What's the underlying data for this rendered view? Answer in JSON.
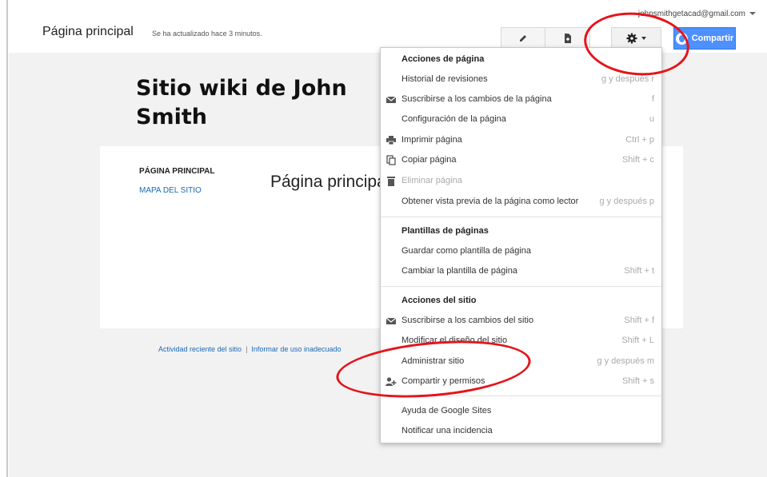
{
  "header": {
    "page_title": "Página principal",
    "updated": "Se ha actualizado hace 3 minutos.",
    "account": "johnsmithgetacad@gmail.com",
    "share_label": "Compartir"
  },
  "site": {
    "title": "Sitio wiki de John Smith",
    "nav": [
      {
        "label": "PÁGINA PRINCIPAL"
      },
      {
        "label": "MAPA DEL SITIO"
      }
    ],
    "content_heading": "Página principal"
  },
  "footer": {
    "link1": "Actividad reciente del sitio",
    "link2": "Informar de uso inadecuado"
  },
  "menu": {
    "sections": [
      {
        "title": "Acciones de página"
      },
      {
        "title": "Plantillas de páginas"
      },
      {
        "title": "Acciones del sitio"
      }
    ],
    "items": [
      {
        "label": "Historial de revisiones",
        "shortcut": "g y después r",
        "icon": "none"
      },
      {
        "label": "Suscribirse a los cambios de la página",
        "shortcut": "f",
        "icon": "mail-icon"
      },
      {
        "label": "Configuración de la página",
        "shortcut": "u",
        "icon": "none"
      },
      {
        "label": "Imprimir página",
        "shortcut": "Ctrl + p",
        "icon": "print-icon"
      },
      {
        "label": "Copiar página",
        "shortcut": "Shift + c",
        "icon": "copy-icon"
      },
      {
        "label": "Eliminar página",
        "shortcut": "",
        "icon": "trash-icon",
        "disabled": true
      },
      {
        "label": "Obtener vista previa de la página como lector",
        "shortcut": "g y después p",
        "icon": "none"
      },
      {
        "label": "Guardar como plantilla de página",
        "shortcut": "",
        "icon": "none"
      },
      {
        "label": "Cambiar la plantilla de página",
        "shortcut": "Shift + t",
        "icon": "none"
      },
      {
        "label": "Suscribirse a los cambios del sitio",
        "shortcut": "Shift + f",
        "icon": "mail-icon"
      },
      {
        "label": "Modificar el diseño del sitio",
        "shortcut": "Shift + L",
        "icon": "none"
      },
      {
        "label": "Administrar sitio",
        "shortcut": "g y después m",
        "icon": "none"
      },
      {
        "label": "Compartir y permisos",
        "shortcut": "Shift + s",
        "icon": "add-person-icon"
      },
      {
        "label": "Ayuda de Google Sites",
        "shortcut": "",
        "icon": "none"
      },
      {
        "label": "Notificar una incidencia",
        "shortcut": "",
        "icon": "none"
      }
    ]
  },
  "colors": {
    "accent": "#4d90fe",
    "link": "#1a6ab7",
    "annotation": "#e5141b"
  }
}
